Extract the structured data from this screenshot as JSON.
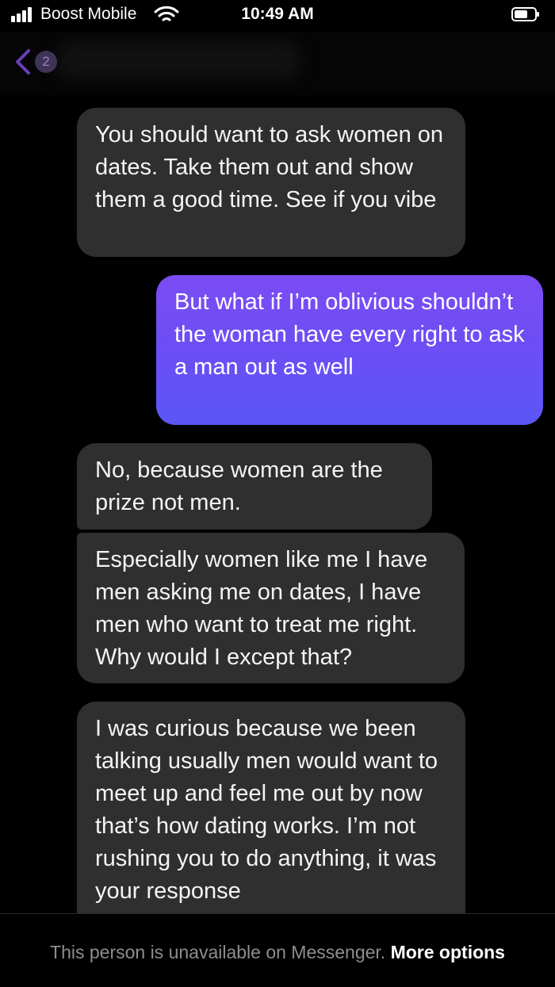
{
  "status_bar": {
    "carrier": "Boost Mobile",
    "time": "10:49 AM"
  },
  "header": {
    "unread_count": "2",
    "accent_color": "#6b3fb8"
  },
  "messages": [
    {
      "sender": "them",
      "text": "You should want to ask women on dates. Take them out and show them a good time. See if you vibe"
    },
    {
      "sender": "me",
      "text": "But what if I’m oblivious shouldn’t the woman have every right to ask a man out as well"
    },
    {
      "sender": "them",
      "text": "No, because women are the prize not men."
    },
    {
      "sender": "them",
      "text": "Especially women like me I have men asking me on dates, I have men who want to treat me right. Why would I except that?"
    },
    {
      "sender": "them",
      "text": "I was curious because we been talking usually men would want to meet up and feel me out by now that’s how dating works. I’m not rushing you to do anything, it was your response"
    }
  ],
  "colors": {
    "incoming_bubble": "#2f2f2f",
    "outgoing_bubble_top": "#7b4cf3",
    "outgoing_bubble_bottom": "#5b56f6"
  },
  "footer": {
    "notice": "This person is unavailable on Messenger.",
    "link": "More options"
  }
}
